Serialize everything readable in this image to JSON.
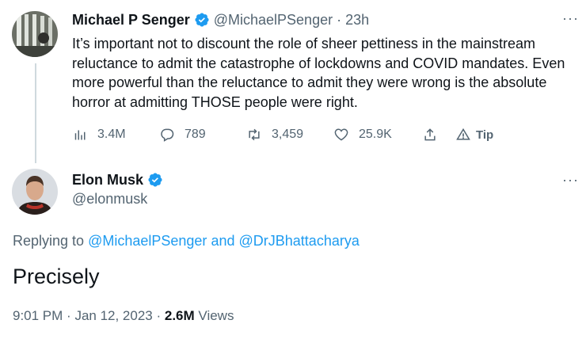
{
  "original_tweet": {
    "author_name": "Michael P Senger",
    "handle": "@MichaelPSenger",
    "separator": "·",
    "time": "23h",
    "more": "···",
    "text": "It’s important not to discount the role of sheer pettiness in the mainstream reluctance to admit the catastrophe of lockdowns and COVID mandates. Even more powerful than the reluctance to admit they were wrong is the absolute horror at admitting THOSE people were right.",
    "views": "3.4M",
    "replies": "789",
    "retweets": "3,459",
    "likes": "25.9K",
    "tip_label": "Tip"
  },
  "reply_tweet": {
    "author_name": "Elon Musk",
    "handle": "@elonmusk",
    "more": "···",
    "replying_prefix": "Replying to",
    "replying_to_1": "@MichaelPSenger",
    "replying_and": "and",
    "replying_to_2": "@DrJBhattacharya",
    "text": "Precisely",
    "time": "9:01 PM",
    "date": "Jan 12, 2023",
    "views_count": "2.6M",
    "views_label": "Views"
  },
  "colors": {
    "verified": "#1d9bf0",
    "link": "#1d9bf0",
    "secondary_text": "#536471",
    "primary_text": "#0f1419"
  }
}
